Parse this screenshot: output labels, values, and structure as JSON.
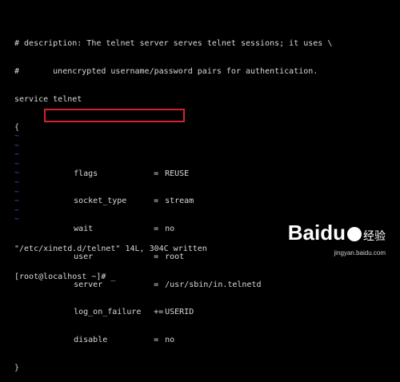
{
  "file_lines": [
    "# description: The telnet server serves telnet sessions; it uses \\",
    "#       unencrypted username/password pairs for authentication.",
    "service telnet",
    "{"
  ],
  "config": [
    {
      "key": "flags",
      "op": "=",
      "value": "REUSE"
    },
    {
      "key": "socket_type",
      "op": "=",
      "value": "stream"
    },
    {
      "key": "wait",
      "op": "=",
      "value": "no"
    },
    {
      "key": "user",
      "op": "=",
      "value": "root"
    },
    {
      "key": "server",
      "op": "=",
      "value": "/usr/sbin/in.telnetd"
    },
    {
      "key": "log_on_failure",
      "op": "+=",
      "value": "USERID"
    },
    {
      "key": "disable",
      "op": "=",
      "value": "no"
    }
  ],
  "closing_brace": "}",
  "tilde_char": "~",
  "tilde_count": 10,
  "status_line": "\"/etc/xinetd.d/telnet\" 14L, 304C written",
  "prompt": "[root@localhost ~]# _",
  "watermark": {
    "brand": "Baidu",
    "sub": "经验",
    "url": "jingyan.baidu.com"
  },
  "colors": {
    "highlight_box": "#d2232a",
    "tilde": "#3a55d8"
  }
}
